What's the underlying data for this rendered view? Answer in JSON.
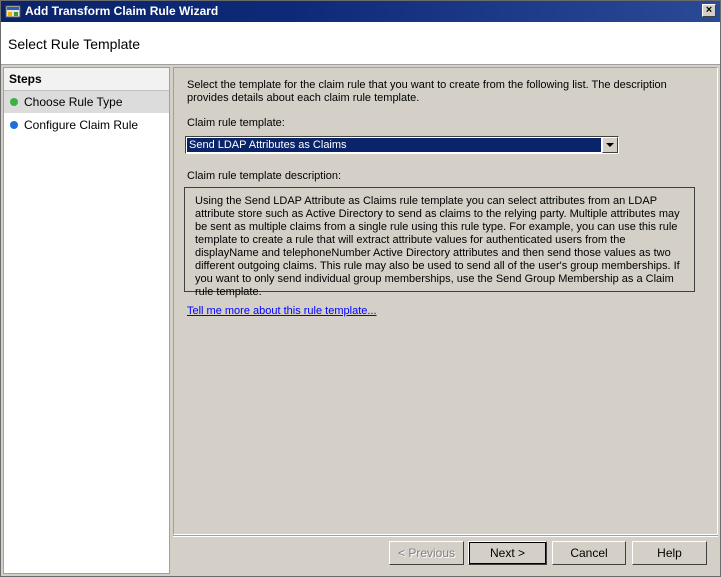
{
  "window": {
    "title": "Add Transform Claim Rule Wizard",
    "close_label": "×"
  },
  "header": {
    "title": "Select Rule Template"
  },
  "steps": {
    "heading": "Steps",
    "items": [
      {
        "label": "Choose Rule Type",
        "status_color": "#3cb043",
        "active": true
      },
      {
        "label": "Configure Claim Rule",
        "status_color": "#1e6fd9",
        "active": false
      }
    ]
  },
  "main": {
    "intro": "Select the template for the claim rule that you want to create from the following list. The description provides details about each claim rule template.",
    "template_label": "Claim rule template:",
    "template_selected": "Send LDAP Attributes as Claims",
    "description_label": "Claim rule template description:",
    "description": "Using the Send LDAP Attribute as Claims rule template you can select attributes from an LDAP attribute store such as Active Directory to send as claims to the relying party. Multiple attributes may be sent as multiple claims from a single rule using this rule type. For example, you can use this rule template to create a rule that will extract attribute values for authenticated users from the displayName and telephoneNumber Active Directory attributes and then send those values as two different outgoing claims. This rule may also be used to send all of the user's group memberships. If you want to only send individual group memberships, use the Send Group Membership as a Claim rule template.",
    "help_link": "Tell me more about this rule template..."
  },
  "footer": {
    "previous_label": "< Previous",
    "next_label": "Next >",
    "cancel_label": "Cancel",
    "help_label": "Help"
  },
  "colors": {
    "title_bar": "#0a246a",
    "selection": "#0a246a",
    "link": "#0000ff",
    "dialog_face": "#d4d0c8"
  }
}
